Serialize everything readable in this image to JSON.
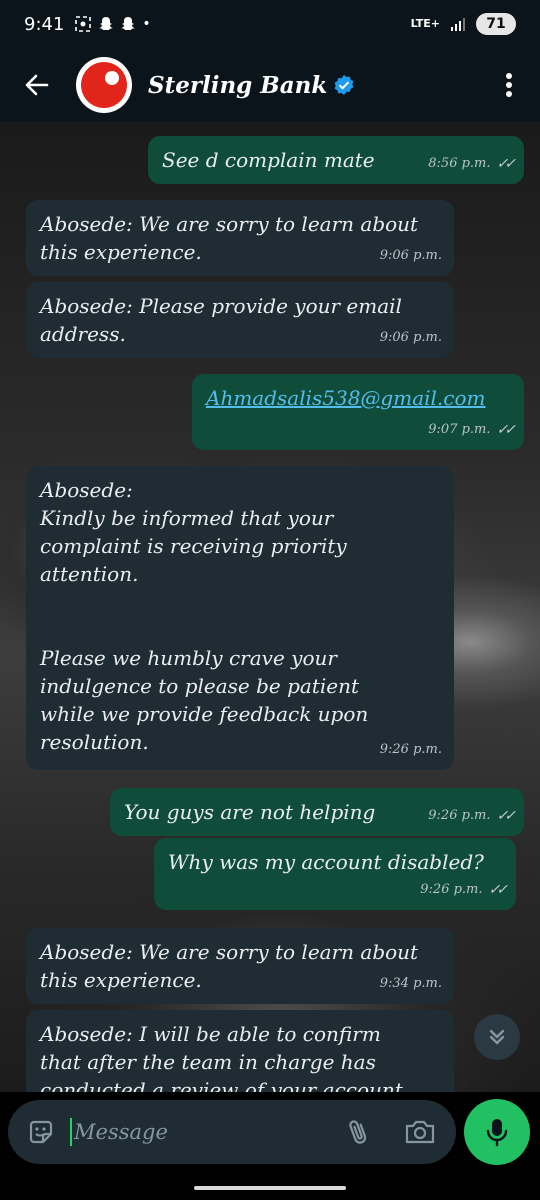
{
  "status_bar": {
    "time": "9:41",
    "network": "LTE+",
    "battery": "71"
  },
  "header": {
    "name": "Sterling Bank",
    "accent": "#e1251b"
  },
  "messages": [
    {
      "dir": "out",
      "text": "See d complain mate",
      "time": "8:56 p.m."
    },
    {
      "dir": "in",
      "text": "Abosede: We are sorry to learn about\nthis experience.",
      "time": "9:06 p.m."
    },
    {
      "dir": "in",
      "text": "Abosede: Please provide your email\naddress.",
      "time": "9:06 p.m."
    },
    {
      "dir": "out",
      "text": "Ahmadsalis538@gmail.com",
      "time": "9:07 p.m."
    },
    {
      "dir": "in",
      "text": "Abosede:\nKindly be informed that your\ncomplaint is receiving priority\nattention.\n\n\nPlease we humbly crave your\nindulgence to please be patient\nwhile we provide feedback upon\nresolution.",
      "time": "9:26 p.m."
    },
    {
      "dir": "out",
      "text": "You guys are not helping",
      "time": "9:26 p.m."
    },
    {
      "dir": "out",
      "text": "Why was my account disabled?",
      "time": "9:26 p.m."
    },
    {
      "dir": "in",
      "text": "Abosede: We are sorry to learn about\nthis experience.",
      "time": "9:34 p.m."
    },
    {
      "dir": "in",
      "text": "Abosede: I will be able to confirm\nthat after the team in charge has\nconducted a review of your account."
    }
  ],
  "composer": {
    "placeholder": "Message"
  },
  "colors": {
    "incoming_bubble": "#202c33",
    "outgoing_bubble": "#0f4d3a",
    "mic_button": "#21c063"
  }
}
